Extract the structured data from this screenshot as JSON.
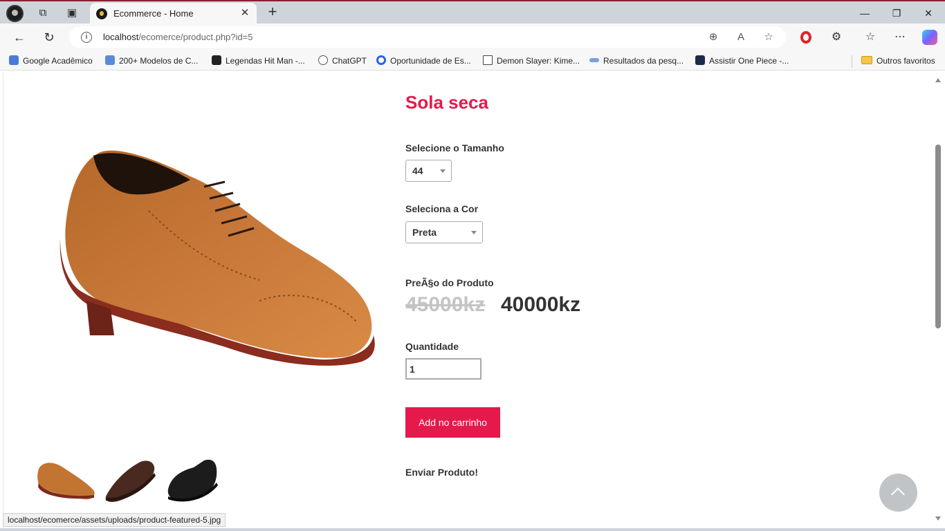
{
  "browser": {
    "tab_title": "Ecommerce - Home",
    "url_host": "localhost",
    "url_path": "/ecomerce/product.php?id=5",
    "status_url": "localhost/ecomerce/assets/uploads/product-featured-5.jpg",
    "bookmarks": [
      {
        "label": "Google Acadêmico",
        "icon": "graduation-icon",
        "color": "#4a7bd6"
      },
      {
        "label": "200+ Modelos de C...",
        "icon": "template-icon",
        "color": "#5b8bd8"
      },
      {
        "label": "Legendas Hit Man -...",
        "icon": "film-icon",
        "color": "#222222"
      },
      {
        "label": "ChatGPT",
        "icon": "chatgpt-icon",
        "color": "#555555"
      },
      {
        "label": "Oportunidade de Es...",
        "icon": "circle-icon",
        "color": "#2563eb"
      },
      {
        "label": "Demon Slayer: Kime...",
        "icon": "page-icon",
        "color": "#ffffff"
      },
      {
        "label": "Resultados da pesq...",
        "icon": "search-result-icon",
        "color": "#7aa0d8"
      },
      {
        "label": "Assistir One Piece -...",
        "icon": "fire-icon",
        "color": "#1b2b4a"
      }
    ],
    "other_favorites": "Outros favoritos"
  },
  "product": {
    "title": "Sola seca",
    "size_label": "Selecione o Tamanho",
    "size_value": "44",
    "color_label": "Seleciona a Cor",
    "color_value": "Preta",
    "price_label": "PreÃ§o do Produto",
    "old_price": "45000kz",
    "new_price": "40000kz",
    "qty_label": "Quantidade",
    "qty_value": "1",
    "add_button": "Add no carrinho",
    "send_label": "Enviar Produto!"
  },
  "colors": {
    "accent": "#e5194c",
    "text": "#333333",
    "old_price": "#c4c4c4"
  }
}
